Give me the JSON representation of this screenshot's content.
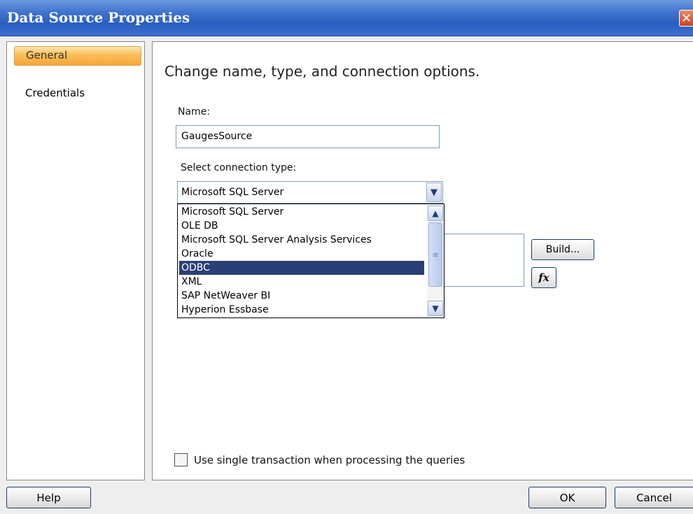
{
  "window": {
    "title": "Data Source Properties",
    "close_glyph": "✕"
  },
  "nav": {
    "items": [
      {
        "label": "General",
        "selected": true
      },
      {
        "label": "Credentials",
        "selected": false
      }
    ]
  },
  "content": {
    "heading": "Change name, type, and connection options.",
    "name_label": "Name:",
    "name_value": "GaugesSource",
    "connection_type_label": "Select connection type:",
    "connection_type_selected": "Microsoft SQL Server",
    "connection_type_options": [
      "Microsoft SQL Server",
      "OLE DB",
      "Microsoft SQL Server Analysis Services",
      "Oracle",
      "ODBC",
      "XML",
      "SAP NetWeaver BI",
      "Hyperion Essbase"
    ],
    "highlighted_option": "ODBC",
    "build_label": "Build...",
    "fx_label": "fx",
    "transaction_checkbox_label": "Use single transaction when processing the queries",
    "transaction_checked": false
  },
  "footer": {
    "help_label": "Help",
    "ok_label": "OK",
    "cancel_label": "Cancel"
  },
  "colors": {
    "titlebar": "#2b5fbf",
    "nav_selected": "#f7a43a",
    "highlight": "#2a3f75"
  },
  "icons": {
    "combo_arrow": "chevron-down-icon",
    "scroll_up": "chevron-up-icon",
    "scroll_down": "chevron-down-icon",
    "close": "close-icon"
  }
}
